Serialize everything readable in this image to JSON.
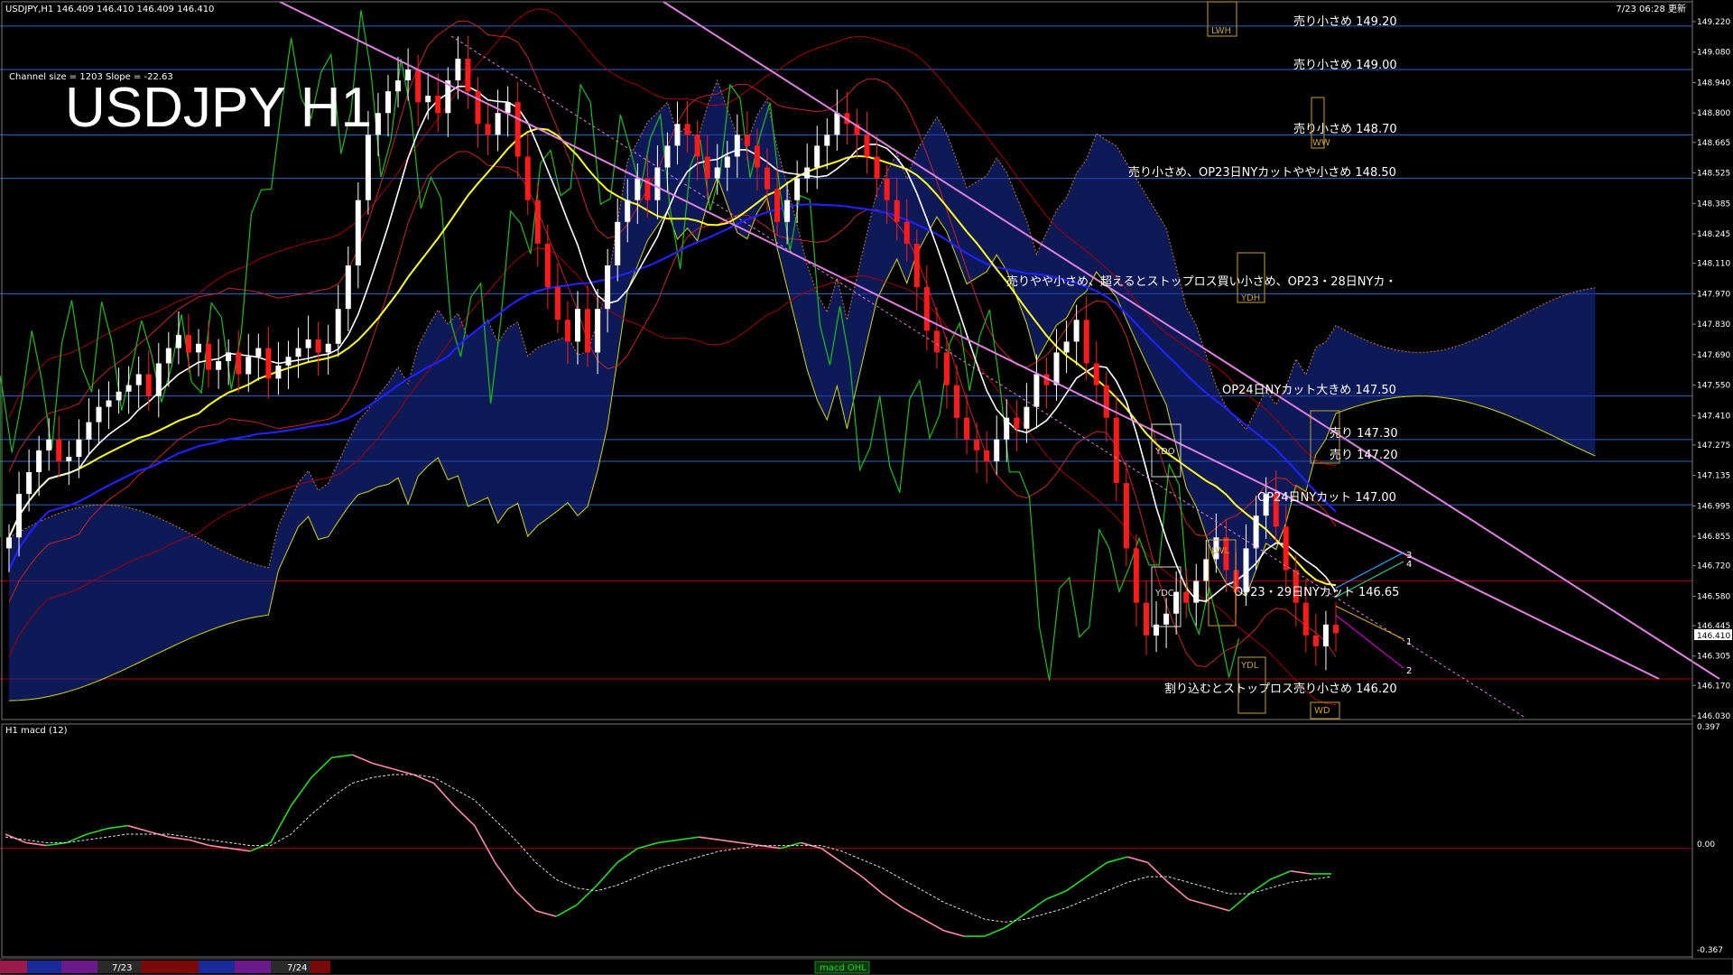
{
  "header": {
    "symbol_info": "USDJPY,H1  146.409 146.410 146.409 146.410",
    "timestamp": "7/23 06:28 更新",
    "channel_info": "Channel size = 1203 Slope = -22.63",
    "big_title": "USDJPY H1",
    "macd_label": "H1  macd (12)"
  },
  "price_axis": [
    "149.220",
    "149.080",
    "148.940",
    "148.800",
    "148.665",
    "148.525",
    "148.385",
    "148.245",
    "148.110",
    "147.970",
    "147.830",
    "147.690",
    "147.550",
    "147.410",
    "147.275",
    "147.135",
    "146.995",
    "146.855",
    "146.720",
    "146.580",
    "146.445",
    "146.305",
    "146.170",
    "146.030"
  ],
  "current_price": "146.410",
  "macd_axis": [
    "0.397",
    "0.00",
    "-0.367"
  ],
  "levels": [
    {
      "label": "売り小さめ 149.20"
    },
    {
      "label": "売り小さめ 149.00"
    },
    {
      "label": "売り小さめ 148.70"
    },
    {
      "label": "売り小さめ、OP23日NYカットやや小さめ 148.50"
    },
    {
      "label": "売りやや小さめ、超えるとストップロス買い小さめ、OP23・28日NYカ・"
    },
    {
      "label": "OP24日NYカット大きめ 147.50"
    },
    {
      "label": "売り 147.30"
    },
    {
      "label": "売り 147.20"
    },
    {
      "label": "OP24日NYカット 147.00"
    },
    {
      "label": "OP23・29日NYカット 146.65"
    },
    {
      "label": "割り込むとストップロス売り小さめ 146.20"
    }
  ],
  "boxes": {
    "lwh": "LWH",
    "ww": "WW",
    "ydh": "YDH",
    "ydo": "YDO",
    "ydc": "YDC",
    "lwl": "LWL",
    "ydl": "YDL",
    "wd": "WD"
  },
  "projection_labels": [
    "3",
    "4",
    "1",
    "2"
  ],
  "bottom_bar": {
    "date1": "7/23",
    "date2": "7/24",
    "macd_tab": "macd OHL"
  },
  "colors": {
    "bull": "#ffffff",
    "bear": "#ff1a1a",
    "level_line": "#2e66c8",
    "red_level": "#b00000",
    "sma_slow": "#2020ff",
    "sma_mid": "#ffff22",
    "sma_fast": "#ffffff",
    "chikou": "#19c019",
    "cloud_blue": "#1a2ea0",
    "cloud_orange": "#c87a3c",
    "channel": "#e080e0",
    "macd_up": "#22dd22",
    "macd_down": "#ff88aa"
  },
  "chart_data": {
    "type": "candlestick",
    "timeframe": "H1",
    "symbol": "USDJPY",
    "ylim": [
      146.03,
      149.22
    ],
    "x_ticks": [
      "7/23",
      "7/24"
    ],
    "horizontal_levels": [
      149.2,
      149.0,
      148.7,
      148.5,
      147.97,
      147.5,
      147.3,
      147.2,
      147.0,
      146.65,
      146.2
    ],
    "close_trail": [
      146.85,
      147.05,
      147.15,
      147.25,
      147.3,
      147.2,
      147.22,
      147.3,
      147.38,
      147.45,
      147.48,
      147.52,
      147.55,
      147.6,
      147.5,
      147.65,
      147.72,
      147.78,
      147.7,
      147.74,
      147.62,
      147.66,
      147.7,
      147.6,
      147.68,
      147.72,
      147.58,
      147.64,
      147.68,
      147.72,
      147.76,
      147.7,
      147.74,
      147.9,
      148.1,
      148.4,
      148.7,
      148.8,
      148.9,
      148.95,
      149.0,
      148.85,
      148.88,
      148.8,
      148.95,
      149.05,
      148.9,
      148.75,
      148.7,
      148.8,
      148.85,
      148.6,
      148.4,
      148.2,
      148.0,
      147.85,
      147.75,
      147.9,
      147.7,
      147.9,
      148.1,
      148.3,
      148.4,
      148.5,
      148.4,
      148.55,
      148.65,
      148.75,
      148.7,
      148.6,
      148.5,
      148.55,
      148.6,
      148.7,
      148.65,
      148.55,
      148.45,
      148.3,
      148.4,
      148.5,
      148.55,
      148.65,
      148.7,
      148.8,
      148.75,
      148.7,
      148.6,
      148.5,
      148.4,
      148.3,
      148.2,
      148.0,
      147.8,
      147.7,
      147.55,
      147.4,
      147.3,
      147.25,
      147.2,
      147.3,
      147.4,
      147.35,
      147.45,
      147.6,
      147.55,
      147.7,
      147.75,
      147.85,
      147.65,
      147.55,
      147.4,
      147.1,
      146.8,
      146.55,
      146.4,
      146.45,
      146.5,
      146.6,
      146.55,
      146.65,
      146.75,
      146.85,
      146.7,
      146.6,
      146.8,
      146.95,
      147.05,
      146.9,
      146.7,
      146.55,
      146.4,
      146.35,
      146.45,
      146.41
    ]
  },
  "macd_chart": {
    "type": "line",
    "ylim": [
      -0.367,
      0.397
    ],
    "macd": [
      0.05,
      0.02,
      0.01,
      0.02,
      0.05,
      0.07,
      0.08,
      0.06,
      0.04,
      0.03,
      0.01,
      0.0,
      -0.01,
      0.02,
      0.15,
      0.25,
      0.32,
      0.33,
      0.3,
      0.28,
      0.26,
      0.23,
      0.15,
      0.08,
      -0.05,
      -0.15,
      -0.22,
      -0.24,
      -0.2,
      -0.13,
      -0.05,
      0.0,
      0.02,
      0.03,
      0.04,
      0.03,
      0.02,
      0.01,
      0.0,
      0.02,
      0.0,
      -0.05,
      -0.1,
      -0.16,
      -0.21,
      -0.25,
      -0.29,
      -0.31,
      -0.31,
      -0.28,
      -0.23,
      -0.18,
      -0.15,
      -0.1,
      -0.05,
      -0.03,
      -0.05,
      -0.12,
      -0.18,
      -0.2,
      -0.22,
      -0.16,
      -0.11,
      -0.08,
      -0.09,
      -0.09
    ],
    "signal": [
      0.04,
      0.03,
      0.02,
      0.02,
      0.03,
      0.04,
      0.05,
      0.05,
      0.05,
      0.04,
      0.03,
      0.02,
      0.01,
      0.01,
      0.05,
      0.12,
      0.18,
      0.23,
      0.25,
      0.26,
      0.26,
      0.25,
      0.21,
      0.17,
      0.1,
      0.03,
      -0.05,
      -0.11,
      -0.14,
      -0.15,
      -0.13,
      -0.1,
      -0.07,
      -0.05,
      -0.03,
      -0.01,
      0.0,
      0.01,
      0.01,
      0.01,
      0.01,
      -0.01,
      -0.04,
      -0.07,
      -0.11,
      -0.15,
      -0.19,
      -0.22,
      -0.25,
      -0.26,
      -0.25,
      -0.23,
      -0.21,
      -0.18,
      -0.15,
      -0.12,
      -0.1,
      -0.1,
      -0.12,
      -0.14,
      -0.16,
      -0.16,
      -0.14,
      -0.12,
      -0.11,
      -0.1
    ]
  }
}
